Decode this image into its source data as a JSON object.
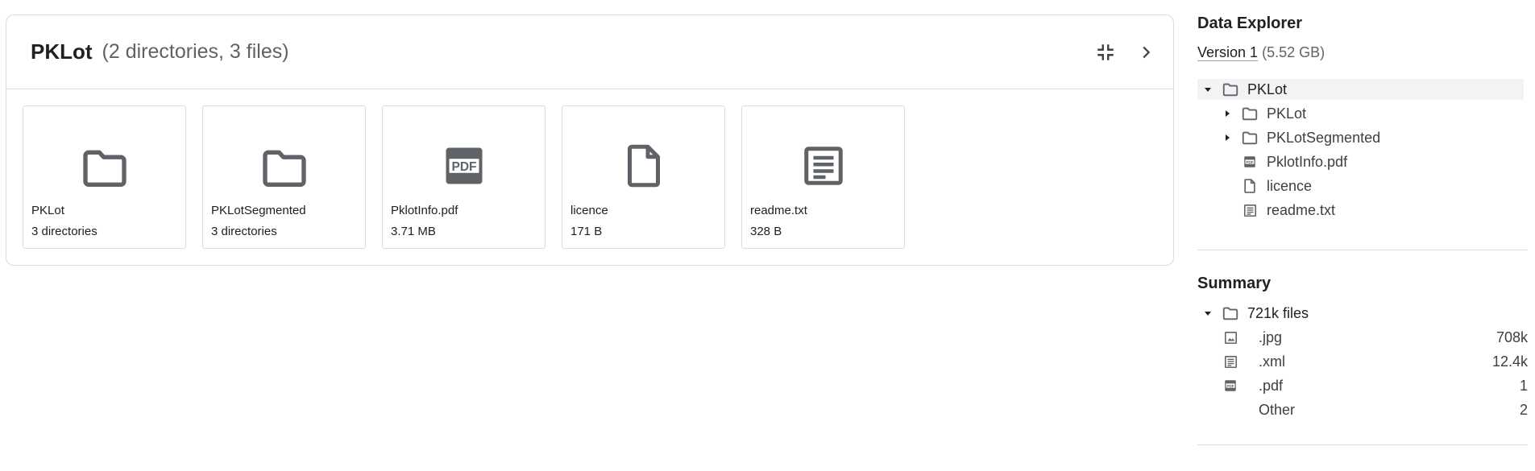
{
  "panel": {
    "title": "PKLot",
    "count": "(2 directories, 3 files)",
    "actions": [
      "collapse-icon",
      "chevron-right-icon"
    ]
  },
  "cards": [
    {
      "icon": "folder-icon",
      "name": "PKLot",
      "meta": "3 directories"
    },
    {
      "icon": "folder-icon",
      "name": "PKLotSegmented",
      "meta": "3 directories"
    },
    {
      "icon": "pdf-icon",
      "name": "PklotInfo.pdf",
      "meta": "3.71 MB"
    },
    {
      "icon": "file-icon",
      "name": "licence",
      "meta": "171 B"
    },
    {
      "icon": "text-file-icon",
      "name": "readme.txt",
      "meta": "328 B"
    }
  ],
  "explorer": {
    "title": "Data Explorer",
    "version_link": "Version 1",
    "version_size": "(5.52 GB)",
    "tree": [
      {
        "label": "PKLot",
        "icon": "folder-icon",
        "expanded": true,
        "selected": true
      },
      {
        "label": "PKLot",
        "icon": "folder-icon",
        "expanded": false
      },
      {
        "label": "PKLotSegmented",
        "icon": "folder-icon",
        "expanded": false
      },
      {
        "label": "PklotInfo.pdf",
        "icon": "pdf-icon"
      },
      {
        "label": "licence",
        "icon": "file-icon"
      },
      {
        "label": "readme.txt",
        "icon": "text-file-icon"
      }
    ]
  },
  "summary": {
    "title": "Summary",
    "root_label": "721k files",
    "rows": [
      {
        "icon": "image-icon",
        "ext": ".jpg",
        "count": "708k"
      },
      {
        "icon": "text-file-icon",
        "ext": ".xml",
        "count": "12.4k"
      },
      {
        "icon": "pdf-icon",
        "ext": ".pdf",
        "count": "1"
      },
      {
        "icon": "",
        "ext": "Other",
        "count": "2"
      }
    ]
  },
  "colors": {
    "icon": "#5f6368",
    "border": "#dadce0",
    "selected_bg": "#f1f3f4"
  }
}
